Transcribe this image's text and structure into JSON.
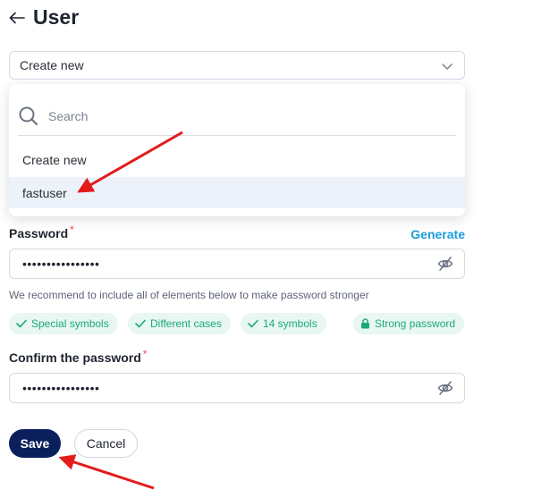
{
  "header": {
    "title": "User",
    "back_icon": "arrow-left-icon"
  },
  "select": {
    "value": "Create new"
  },
  "dropdown": {
    "search_placeholder": "Search",
    "options": [
      "Create new",
      "fastuser"
    ],
    "highlighted_option": "fastuser"
  },
  "password": {
    "label": "Password",
    "required_mark": "*",
    "generate_label": "Generate",
    "value": "••••••••••••••••"
  },
  "hint": "We recommend to include all of elements below to make password stronger",
  "chips": [
    "Special symbols",
    "Different cases",
    "14 symbols",
    "Strong password"
  ],
  "confirm": {
    "label": "Confirm the password",
    "required_mark": "*",
    "value": "••••••••••••••••"
  },
  "buttons": {
    "save": "Save",
    "cancel": "Cancel"
  },
  "colors": {
    "primary_dark": "#0b1f5c",
    "link": "#1a9dd9",
    "chip_text": "#1aa97a",
    "chip_bg": "#e8f7f1",
    "required": "#e54b4b",
    "annotation_arrow": "#e31b1b",
    "highlight_row": "#edf2fa"
  }
}
